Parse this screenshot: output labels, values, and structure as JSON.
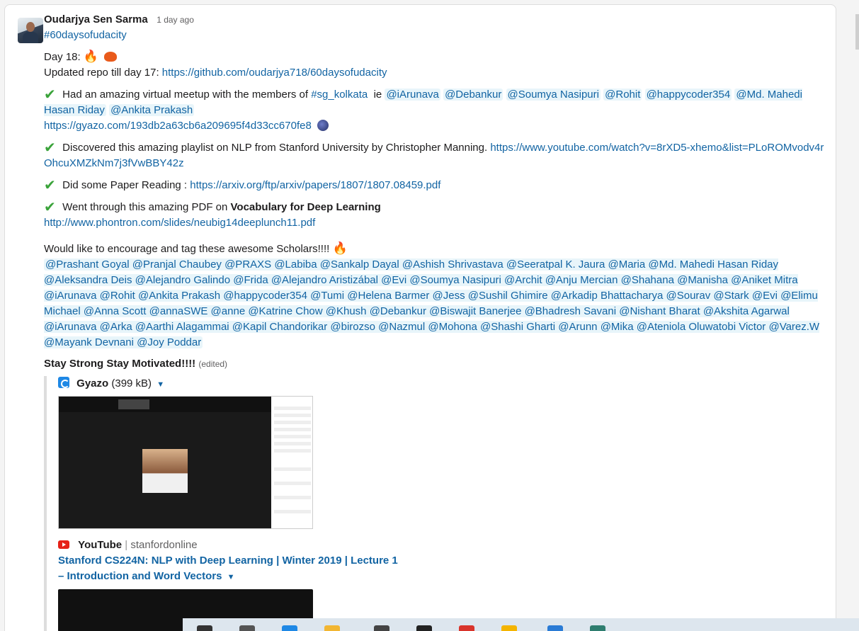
{
  "message": {
    "sender": "Oudarjya Sen Sarma",
    "timestamp": "1 day ago",
    "hashtag": "#60daysofudacity",
    "day_label": "Day 18:",
    "repo_prefix": "Updated repo till day 17:",
    "repo_link": "https://github.com/oudarjya718/60daysofudacity",
    "meetup_text": "Had an amazing virtual meetup with the members of",
    "meetup_channel": "#sg_kolkata",
    "meetup_ie": "ie",
    "meetup_mentions": [
      "@iArunava",
      "@Debankur",
      "@Soumya Nasipuri",
      "@Rohit",
      "@happycoder354",
      "@Md. Mahedi Hasan Riday",
      "@Ankita Prakash"
    ],
    "gyazo_link": "https://gyazo.com/193db2a63cb6a209695f4d33cc670fe8",
    "playlist_text": "Discovered this  amazing playlist on NLP from Stanford University by Christopher Manning.",
    "playlist_link": "https://www.youtube.com/watch?v=8rXD5-xhemo&list=PLoROMvodv4rOhcuXMZkNm7j3fVwBBY42z",
    "paper_text": "Did some Paper Reading :",
    "paper_link": "https://arxiv.org/ftp/arxiv/papers/1807/1807.08459.pdf",
    "pdf_text": "Went through this amazing PDF on",
    "pdf_bold": "Vocabulary for Deep Learning",
    "pdf_link": "http://www.phontron.com/slides/neubig14deeplunch11.pdf",
    "encourage_text": "Would like to encourage and tag these awesome Scholars!!!!",
    "scholar_mentions": "@Prashant Goyal @Pranjal Chaubey @PRAXS @Labiba @Sankalp Dayal @Ashish Shrivastava @Seeratpal K. Jaura @Maria @Md. Mahedi Hasan Riday @Aleksandra Deis @Alejandro Galindo @Frida @Alejandro Aristizábal @Evi @Soumya Nasipuri @Archit @Anju Mercian @Shahana @Manisha @Aniket Mitra @iArunava @Rohit @Ankita Prakash @happycoder354 @Tumi @Helena Barmer @Jess @Sushil Ghimire @Arkadip Bhattacharya @Sourav @Stark @Evi @Elimu Michael @Anna Scott @annaSWE @anne @Katrine Chow @Khush @Debankur @Biswajit Banerjee @Bhadresh Savani @Nishant Bharat @Akshita Agarwal @iArunava @Arka @Aarthi Alagammai @Kapil Chandorikar @birozso @Nazmul @Mohona @Shashi Gharti @Arunn @Mika @Ateniola Oluwatobi Victor @Varez.W @Mayank Devnani @Joy Poddar",
    "closing": "Stay Strong Stay Motivated!!!!",
    "edited": "(edited)"
  },
  "gyazo_attachment": {
    "name": "Gyazo",
    "size": "(399 kB)"
  },
  "youtube_attachment": {
    "service": "YouTube",
    "channel": "stanfordonline",
    "title": "Stanford CS224N: NLP with Deep Learning | Winter 2019 | Lecture 1 – Introduction and Word Vectors"
  },
  "icons": [
    "fire-emoji",
    "blob-emoji",
    "check-emoji",
    "gyazo-icon",
    "youtube-icon",
    "caret-down-icon"
  ],
  "colors": {
    "link": "#1264a3",
    "mention_bg": "#e8f5fa",
    "check": "#3aa33a"
  }
}
